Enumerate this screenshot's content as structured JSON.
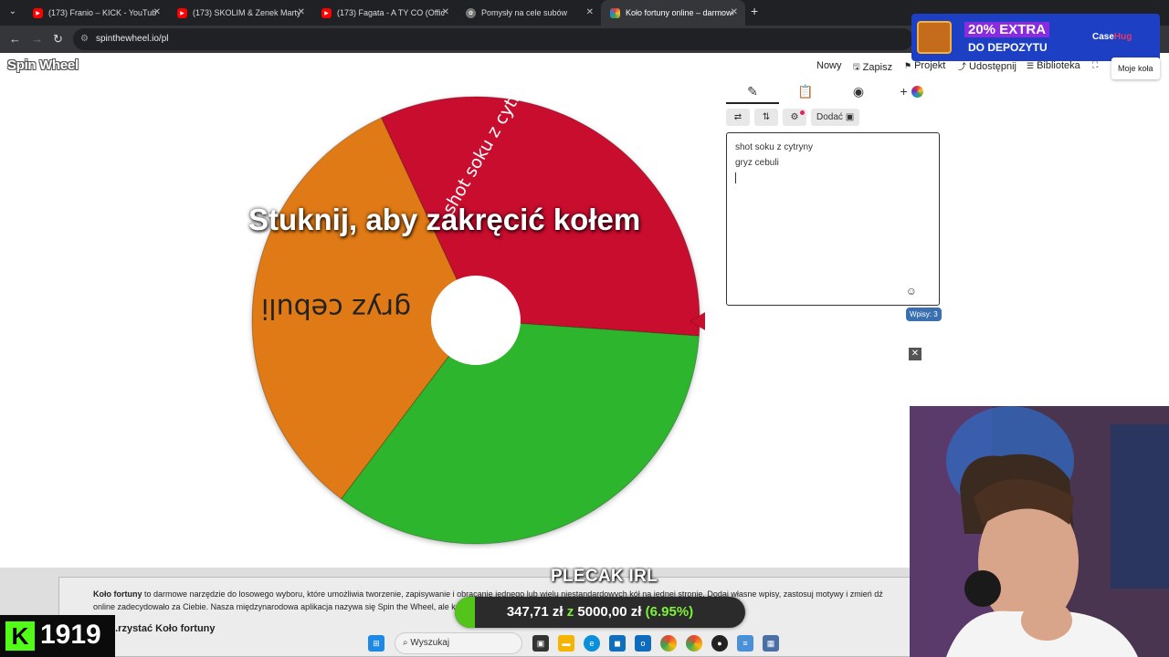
{
  "browser": {
    "tabs": [
      {
        "title": "(173) Franio – KICK - YouTube",
        "icon": "youtube-icon"
      },
      {
        "title": "(173) SKOLIM & Zenek Martyniuk",
        "icon": "youtube-icon"
      },
      {
        "title": "(173) Fagata - A TY CO (Official",
        "icon": "youtube-icon"
      },
      {
        "title": "Pomysły na cele subów",
        "icon": "chatgpt-icon"
      },
      {
        "title": "Koło fortuny online – darmowe",
        "icon": "spinthewheel-icon"
      }
    ],
    "url": "spinthewheel.io/pl"
  },
  "ad": {
    "line1": "20% EXTRA",
    "line2": "DO DEPOZYTU",
    "brand_a": "Case",
    "brand_b": "Hug"
  },
  "site": {
    "logo": "Spin Wheel",
    "nav": {
      "new": "Nowy",
      "save": "Zapisz",
      "project": "Projekt",
      "share": "Udostępnij",
      "library": "Biblioteka",
      "my_wheels": "Moje koła"
    }
  },
  "wheel": {
    "spin_prompt": "Stuknij, aby zakręcić kołem",
    "segments": [
      {
        "label": "shot soku z cytry...",
        "color": "#c8102e"
      },
      {
        "label": "",
        "color": "#2db52d"
      },
      {
        "label": "gryz cebuli",
        "color": "#e07a16"
      }
    ]
  },
  "editor": {
    "tools": {
      "add": "Dodać"
    },
    "entries": [
      "shot soku z cytryny",
      "gryz cebuli"
    ],
    "count": "Wpisy: 3"
  },
  "info": {
    "brand": "Koło fortuny",
    "text_1": " to darmowe narzędzie do losowego wyboru, które umożliwia tworzenie, zapisywanie i obracanie jednego lub wielu niestandardowych kół na jednej stronie. Dodaj własne wpisy, zastosuj motywy i zmień dź",
    "text_2": "online zadecydowało za Ciebie. Nasza międzynarodowa aplikacja nazywa się Spin the Wheel, ale korzystanie jest ... więcej funkcji wszystkie funkcje.",
    "heading": "...rzystać Koło fortuny"
  },
  "stream": {
    "goal_title": "PLECAK IRL",
    "goal_current": "347,71 zł",
    "goal_sep": "z",
    "goal_target": "5000,00 zł",
    "goal_percent_text": "(6.95%)",
    "goal_fraction": 0.0695,
    "viewer_count": "1919"
  },
  "taskbar": {
    "search_placeholder": "Wyszukaj"
  }
}
